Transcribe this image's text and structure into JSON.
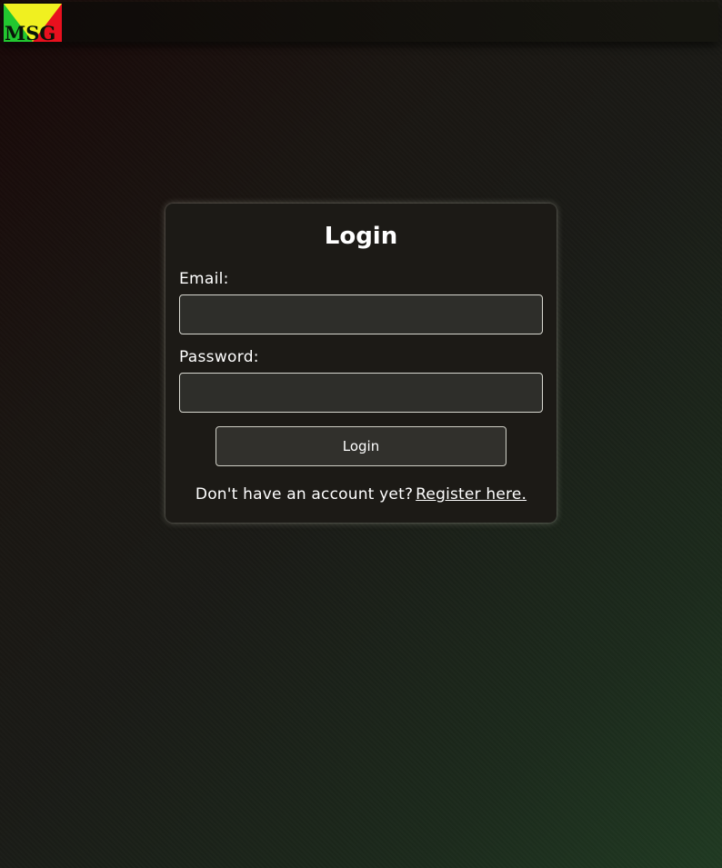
{
  "app": {
    "logo_text": "MSG",
    "colors": {
      "logo_yellow": "#f0f020",
      "logo_red": "#e8101e",
      "logo_green": "#22c830",
      "logo_text": "#0a140a"
    }
  },
  "login": {
    "title": "Login",
    "email_label": "Email:",
    "email_value": "",
    "email_placeholder": "",
    "password_label": "Password:",
    "password_value": "",
    "password_placeholder": "",
    "submit_label": "Login",
    "register_prompt": "Don't have an account yet?",
    "register_link": "Register here."
  }
}
